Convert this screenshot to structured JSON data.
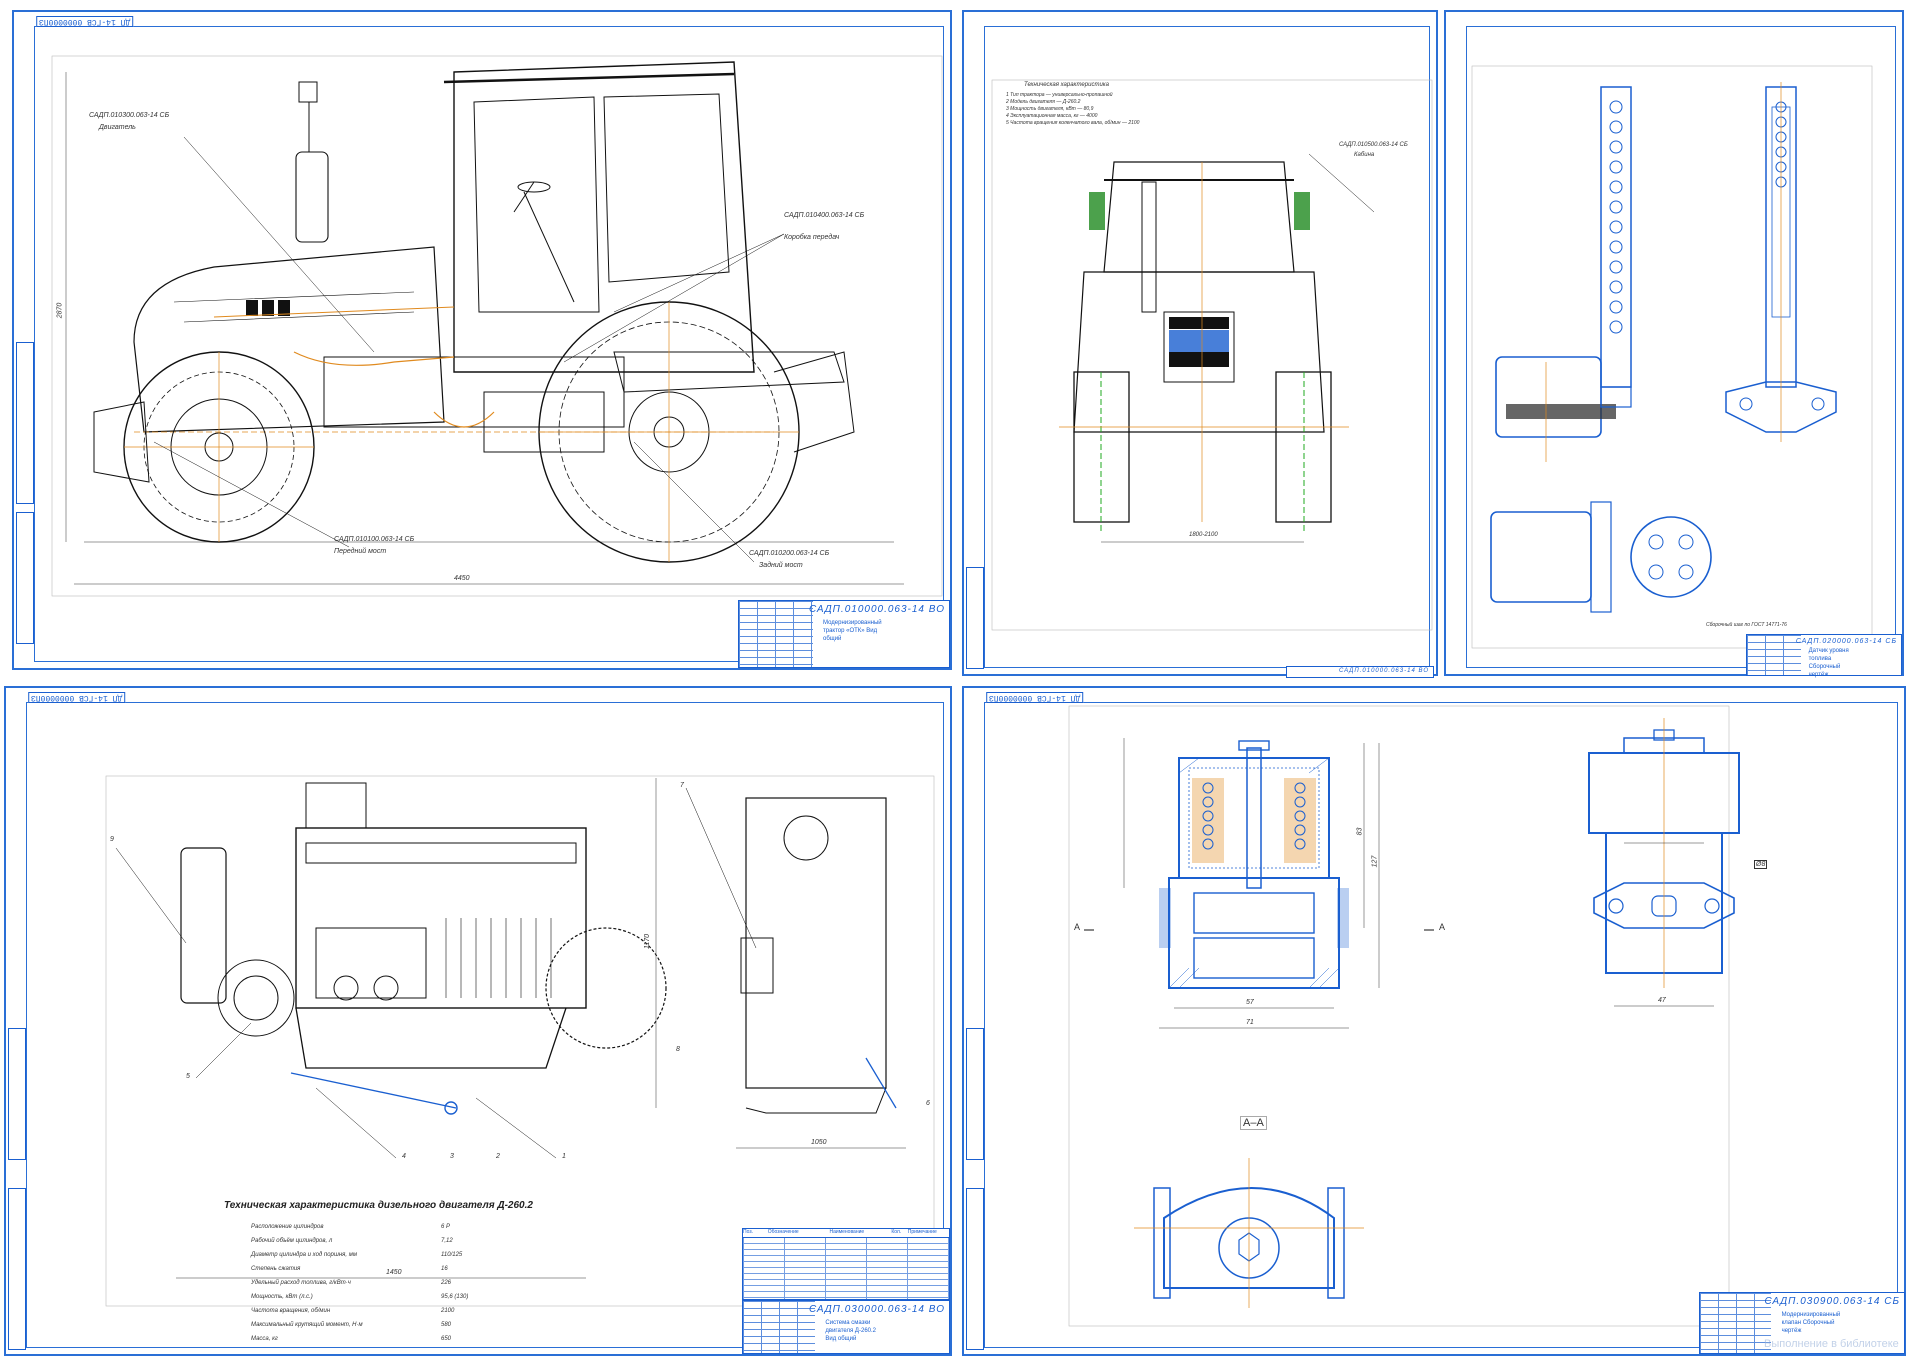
{
  "sheets": {
    "tractor_side": {
      "code": "ДП 14-ГСВ 0000000ПЗ",
      "title_code": "САДП.010000.063-14 ВО",
      "title_name": "Модернизированный трактор «ОТК» Вид общий",
      "callouts": [
        {
          "text": "САДП.010300.063-14 СБ",
          "sub": "Двигатель"
        },
        {
          "text": "САДП.010400.063-14 СБ",
          "sub": "Коробка передач"
        },
        {
          "text": "САДП.010100.063-14 СБ",
          "sub": "Передний мост"
        },
        {
          "text": "САДП.010200.063-14 СБ",
          "sub": "Задний мост"
        }
      ],
      "dims": [
        "2870",
        "4450"
      ]
    },
    "tractor_front": {
      "title_code": "САДП.010000.063-14 ВО",
      "spec_header": "Техническая характеристика",
      "spec_lines": [
        "1 Тип трактора — универсально-пропашной",
        "2 Модель двигателя — Д-260.2",
        "3 Мощность двигателя, кВт — 80,9",
        "4 Эксплуатационная масса, кг — 4000",
        "5 Частота вращения коленчатого вала, об/мин — 2100"
      ],
      "callout": "САДП.010500.063-14 СБ",
      "callout_sub": "Кабина",
      "dim": "1800-2100"
    },
    "pump": {
      "title_code": "САДП.020000.063-14 СБ",
      "title_name": "Датчик уровня топлива Сборочный чертёж",
      "note": "Сборочный шаг по ГОСТ 14771-76"
    },
    "engine": {
      "code": "ДП 14-ГСВ 0000000ПЗ",
      "title_code": "САДП.030000.063-14 ВО",
      "title_name": "Система смазки двигателя Д-260.2 Вид общий",
      "spec_title": "Техническая характеристика дизельного двигателя Д-260.2",
      "spec": [
        {
          "k": "Расположение цилиндров",
          "v": "6 Р"
        },
        {
          "k": "Рабочий объём цилиндров, л",
          "v": "7,12"
        },
        {
          "k": "Диаметр цилиндра и ход поршня, мм",
          "v": "110/125"
        },
        {
          "k": "Степень сжатия",
          "v": "16"
        },
        {
          "k": "Удельный расход топлива, г/кВт·ч",
          "v": "226"
        },
        {
          "k": "Мощность, кВт (л.с.)",
          "v": "95,6 (130)"
        },
        {
          "k": "Частота вращения, об/мин",
          "v": "2100"
        },
        {
          "k": "Максимальный крутящий момент, Н·м",
          "v": "580"
        },
        {
          "k": "Масса, кг",
          "v": "650"
        }
      ],
      "bom_headers": [
        "Поз.",
        "Обозначение",
        "Наименование",
        "Кол.",
        "Примечание"
      ],
      "dims": [
        "1450",
        "1170",
        "1050"
      ],
      "callouts": [
        "1",
        "2",
        "3",
        "4",
        "5",
        "6",
        "7",
        "8",
        "9"
      ]
    },
    "valve": {
      "code": "ДП 14-ГСВ 0000000ПЗ",
      "title_code": "САДП.030900.063-14 СБ",
      "title_name": "Модернизированный клапан Сборочный чертёж",
      "section_label": "А–А",
      "cut_a_left": "А",
      "cut_a_right": "А",
      "dims": [
        "57",
        "71",
        "83",
        "127",
        "47",
        "Ø8"
      ],
      "watermark": "Выполнение в библиотеке"
    }
  }
}
